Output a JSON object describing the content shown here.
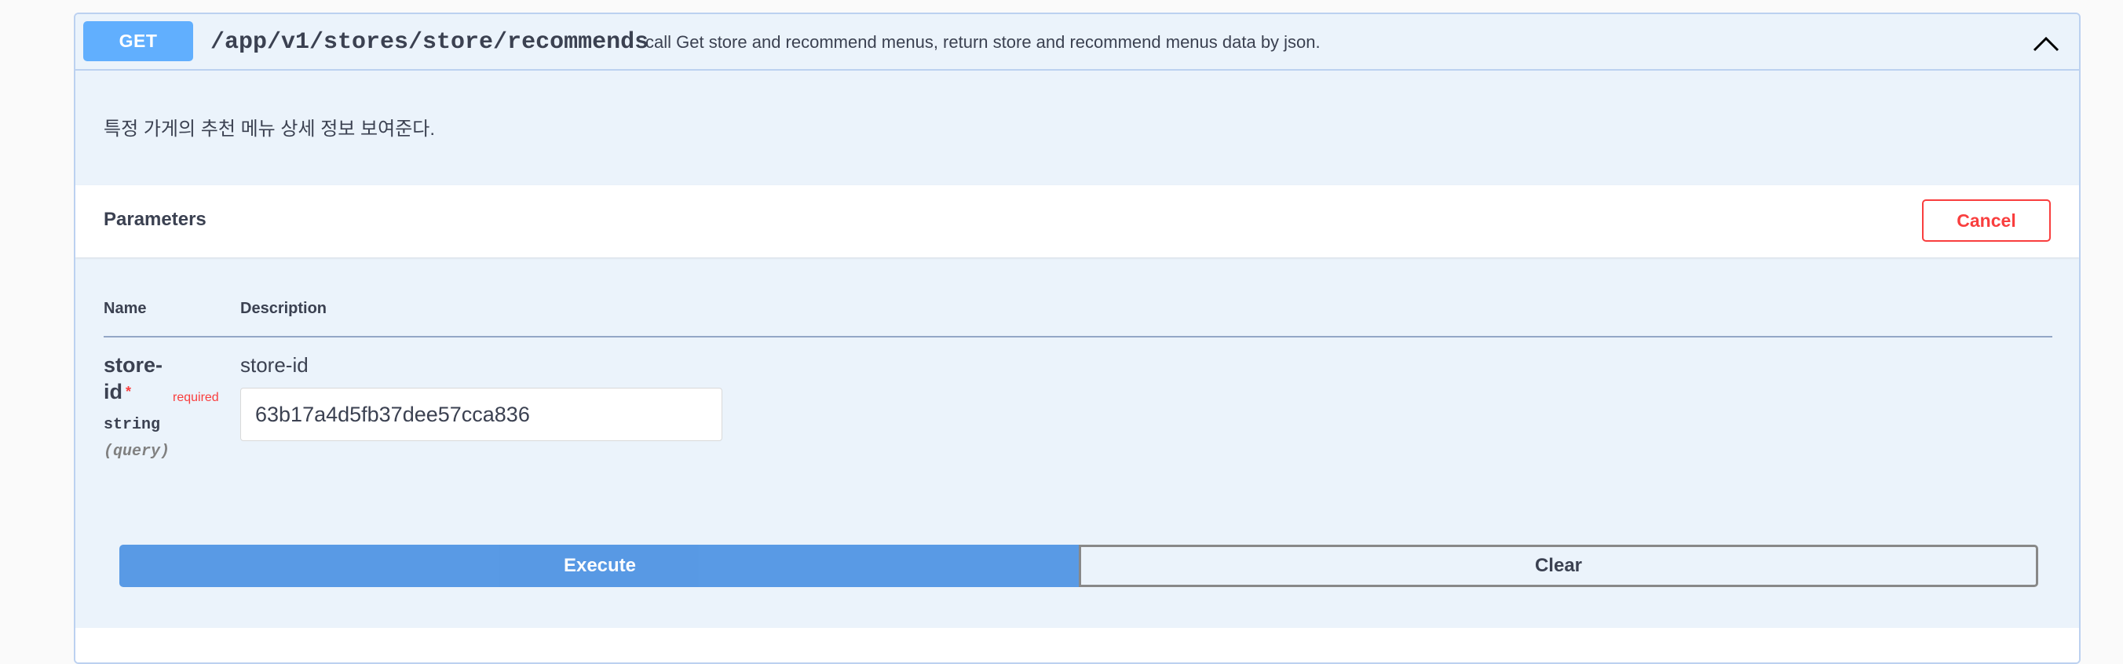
{
  "operation": {
    "method": "GET",
    "path": "/app/v1/stores/store/recommends",
    "summary": "call Get store and recommend menus, return store and recommend menus data by json.",
    "description": "특정 가게의 추천 메뉴 상세 정보 보여준다.",
    "expanded": true
  },
  "parameters": {
    "title": "Parameters",
    "cancel_label": "Cancel",
    "columns": {
      "name": "Name",
      "description": "Description"
    },
    "items": [
      {
        "name": "store-id",
        "required_star": "*",
        "required_label": "required",
        "type": "string",
        "in": "(query)",
        "description": "store-id",
        "value": "63b17a4d5fb37dee57cca836"
      }
    ]
  },
  "actions": {
    "execute_label": "Execute",
    "clear_label": "Clear"
  },
  "colors": {
    "get": "#61affe",
    "execute": "#4990e2",
    "cancel": "#f93e3e",
    "required": "#f93e3e",
    "block_bg": "#ebf3fb",
    "block_border": "#bcd1f0"
  },
  "icons": {
    "collapse": "chevron-up-icon"
  }
}
